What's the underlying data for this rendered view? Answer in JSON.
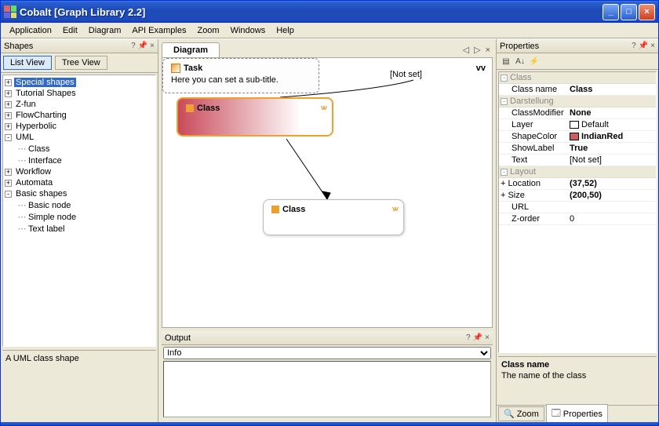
{
  "window": {
    "title": "Cobalt [Graph Library 2.2]"
  },
  "menu": [
    "Application",
    "Edit",
    "Diagram",
    "API Examples",
    "Zoom",
    "Windows",
    "Help"
  ],
  "shapes_panel": {
    "title": "Shapes",
    "list_view": "List View",
    "tree_view": "Tree View",
    "tree": [
      {
        "label": "Special shapes",
        "expandable": true,
        "open": false,
        "selected": true,
        "depth": 0
      },
      {
        "label": "Tutorial Shapes",
        "expandable": true,
        "open": false,
        "depth": 0
      },
      {
        "label": "Z-fun",
        "expandable": true,
        "open": false,
        "depth": 0
      },
      {
        "label": "FlowCharting",
        "expandable": true,
        "open": false,
        "depth": 0
      },
      {
        "label": "Hyperbolic",
        "expandable": true,
        "open": false,
        "depth": 0
      },
      {
        "label": "UML",
        "expandable": true,
        "open": true,
        "depth": 0
      },
      {
        "label": "Class",
        "expandable": false,
        "depth": 1
      },
      {
        "label": "Interface",
        "expandable": false,
        "depth": 1
      },
      {
        "label": "Workflow",
        "expandable": true,
        "open": false,
        "depth": 0
      },
      {
        "label": "Automata",
        "expandable": true,
        "open": false,
        "depth": 0
      },
      {
        "label": "Basic shapes",
        "expandable": true,
        "open": true,
        "depth": 0
      },
      {
        "label": "Basic node",
        "expandable": false,
        "depth": 1
      },
      {
        "label": "Simple node",
        "expandable": false,
        "depth": 1
      },
      {
        "label": "Text label",
        "expandable": false,
        "depth": 1
      }
    ],
    "description": "A UML class shape"
  },
  "diagram": {
    "tab": "Diagram",
    "notset_label": "[Not set]",
    "node1_label": "Class",
    "node2_label": "Class",
    "task_title": "Task",
    "task_sub": "Here you can set a sub-title."
  },
  "output": {
    "title": "Output",
    "dropdown": "Info"
  },
  "properties": {
    "title": "Properties",
    "cats": {
      "class": "Class",
      "darstellung": "Darstellung",
      "layout": "Layout"
    },
    "rows": {
      "classname_k": "Class name",
      "classname_v": "Class",
      "classmod_k": "ClassModifier",
      "classmod_v": "None",
      "layer_k": "Layer",
      "layer_v": "Default",
      "shapecolor_k": "ShapeColor",
      "shapecolor_v": "IndianRed",
      "shapecolor_hex": "#cd5c5c",
      "showlabel_k": "ShowLabel",
      "showlabel_v": "True",
      "text_k": "Text",
      "text_v": "[Not set]",
      "location_k": "Location",
      "location_v": "(37,52)",
      "size_k": "Size",
      "size_v": "(200,50)",
      "url_k": "URL",
      "url_v": "",
      "zorder_k": "Z-order",
      "zorder_v": "0"
    },
    "desc_title": "Class name",
    "desc_text": "The name of the class",
    "tabs": {
      "zoom": "Zoom",
      "props": "Properties"
    }
  }
}
